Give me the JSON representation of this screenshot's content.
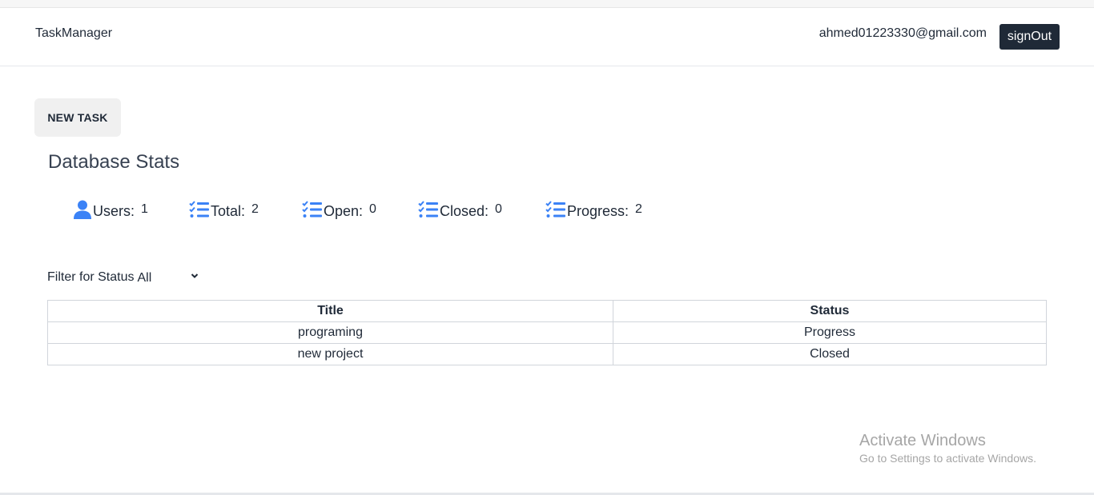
{
  "navbar": {
    "brand": "TaskManager",
    "user_email": "ahmed01223330@gmail.com",
    "signout_label": "signOut"
  },
  "actions": {
    "new_task_label": "NEW TASK"
  },
  "stats": {
    "title": "Database Stats",
    "items": [
      {
        "label": "Users:",
        "value": "1",
        "icon": "user-icon"
      },
      {
        "label": "Total:",
        "value": "2",
        "icon": "task-list-icon"
      },
      {
        "label": "Open:",
        "value": "0",
        "icon": "task-list-icon"
      },
      {
        "label": "Closed:",
        "value": "0",
        "icon": "task-list-icon"
      },
      {
        "label": "Progress:",
        "value": "2",
        "icon": "task-list-icon"
      }
    ]
  },
  "filter": {
    "label": "Filter for Status",
    "selected": "All"
  },
  "table": {
    "headers": [
      "Title",
      "Status"
    ],
    "rows": [
      [
        "programing",
        "Progress"
      ],
      [
        "new project",
        "Closed"
      ]
    ]
  },
  "watermark": {
    "line1": "Activate Windows",
    "line2": "Go to Settings to activate Windows."
  },
  "colors": {
    "accent_icon": "#3b82f6",
    "dark_button": "#1f2937"
  }
}
